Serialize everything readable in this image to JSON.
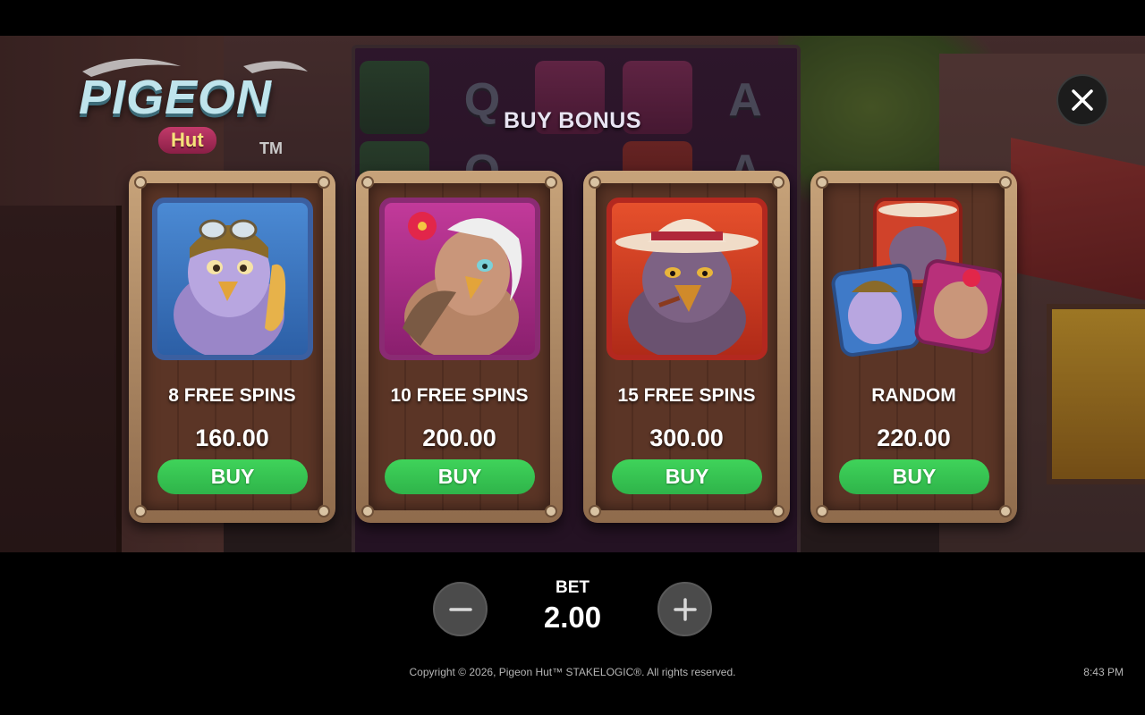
{
  "game": {
    "logo_main": "PIGEON",
    "logo_sub": "Hut",
    "logo_tm": "TM"
  },
  "reels": {
    "letters": [
      "Q",
      "A"
    ]
  },
  "dialog": {
    "title": "BUY BONUS",
    "close_icon": "close-icon",
    "cards": [
      {
        "label": "8 FREE SPINS",
        "price": "160.00",
        "button": "BUY",
        "character": "aviator-pigeon",
        "frame_color": "#3b5fa0"
      },
      {
        "label": "10 FREE SPINS",
        "price": "200.00",
        "button": "BUY",
        "character": "diva-pigeon",
        "frame_color": "#8a2b73"
      },
      {
        "label": "15 FREE SPINS",
        "price": "300.00",
        "button": "BUY",
        "character": "gangster-pigeon",
        "frame_color": "#b3281f"
      },
      {
        "label": "RANDOM",
        "price": "220.00",
        "button": "BUY",
        "character": "random-pigeons",
        "frame_color": "#7a4a35"
      }
    ]
  },
  "bet": {
    "label": "BET",
    "value": "2.00",
    "decrease_icon": "minus-icon",
    "increase_icon": "plus-icon"
  },
  "footer": {
    "copyright": "Copyright © 2026, Pigeon Hut™ STAKELOGIC®. All rights reserved.",
    "time": "8:43 PM"
  },
  "colors": {
    "buy_green": "#37c652",
    "card_wood": "#5b3526",
    "background": "#000000"
  }
}
